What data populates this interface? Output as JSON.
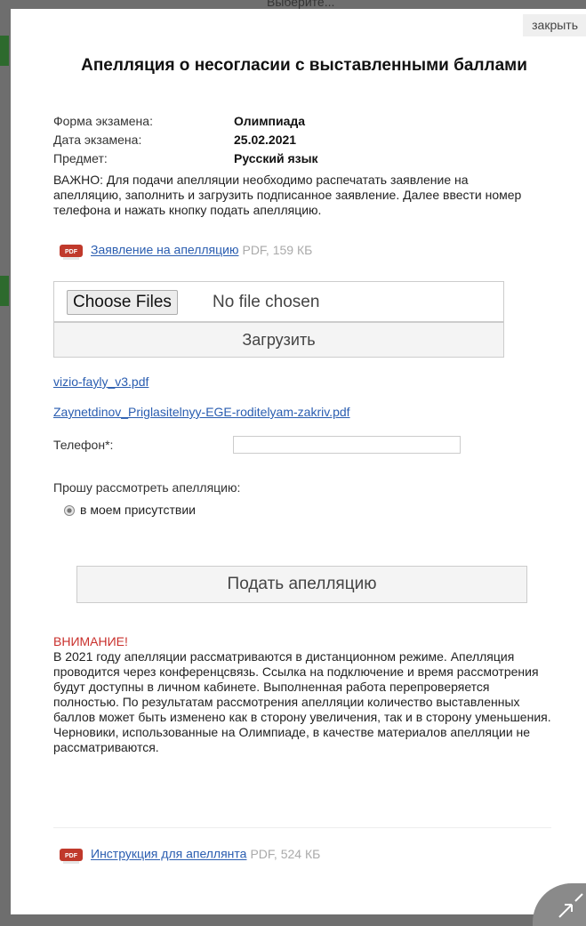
{
  "background": {
    "top_text": "Выберите..."
  },
  "modal": {
    "close_label": "закрыть",
    "title": "Апелляция о несогласии с выставленными баллами",
    "info": [
      {
        "label": "Форма экзамена:",
        "value": "Олимпиада"
      },
      {
        "label": "Дата экзамена:",
        "value": "25.02.2021"
      },
      {
        "label": "Предмет:",
        "value": "Русский язык"
      }
    ],
    "important_text": "ВАЖНО: Для подачи апелляции необходимо распечатать заявление на апелляцию, заполнить и загрузить подписанное заявление. Далее ввести номер телефона и нажать кнопку подать апелляцию.",
    "application_link": {
      "text": "Заявление на апелляцию",
      "meta": "PDF, 159 КБ"
    },
    "file_input": {
      "button": "Choose Files",
      "status": "No file chosen"
    },
    "upload_label": "Загрузить",
    "uploaded_files": [
      "vizio-fayly_v3.pdf",
      "Zaynetdinov_Priglasitelnyy-EGE-roditelyam-zakriv.pdf"
    ],
    "phone_label": "Телефон*:",
    "phone_value": "",
    "request_label": "Прошу рассмотреть апелляцию:",
    "radio_option": "в моем присутствии",
    "submit_label": "Подать апелляцию",
    "warning_title": "ВНИМАНИЕ!",
    "warning_text": "В 2021 году апелляции рассматриваются в дистанционном режиме. Апелляция проводится через конференцсвязь. Ссылка на подключение и время рассмотрения будут доступны в личном кабинете. Выполненная работа перепроверяется полностью. По результатам рассмотрения апелляции количество выставленных баллов может быть изменено как в сторону увеличения, так и в сторону уменьшения. Черновики, использованные на Олимпиаде, в качестве материалов апелляции не рассматриваются.",
    "instruction_link": {
      "text": "Инструкция для апеллянта",
      "meta": "PDF, 524 КБ"
    }
  },
  "colors": {
    "link": "#2a5db0",
    "warning": "#c9302c",
    "pdf_icon": "#c0392b"
  },
  "icons": [
    "pdf-icon",
    "expand-icon",
    "radio-icon"
  ]
}
